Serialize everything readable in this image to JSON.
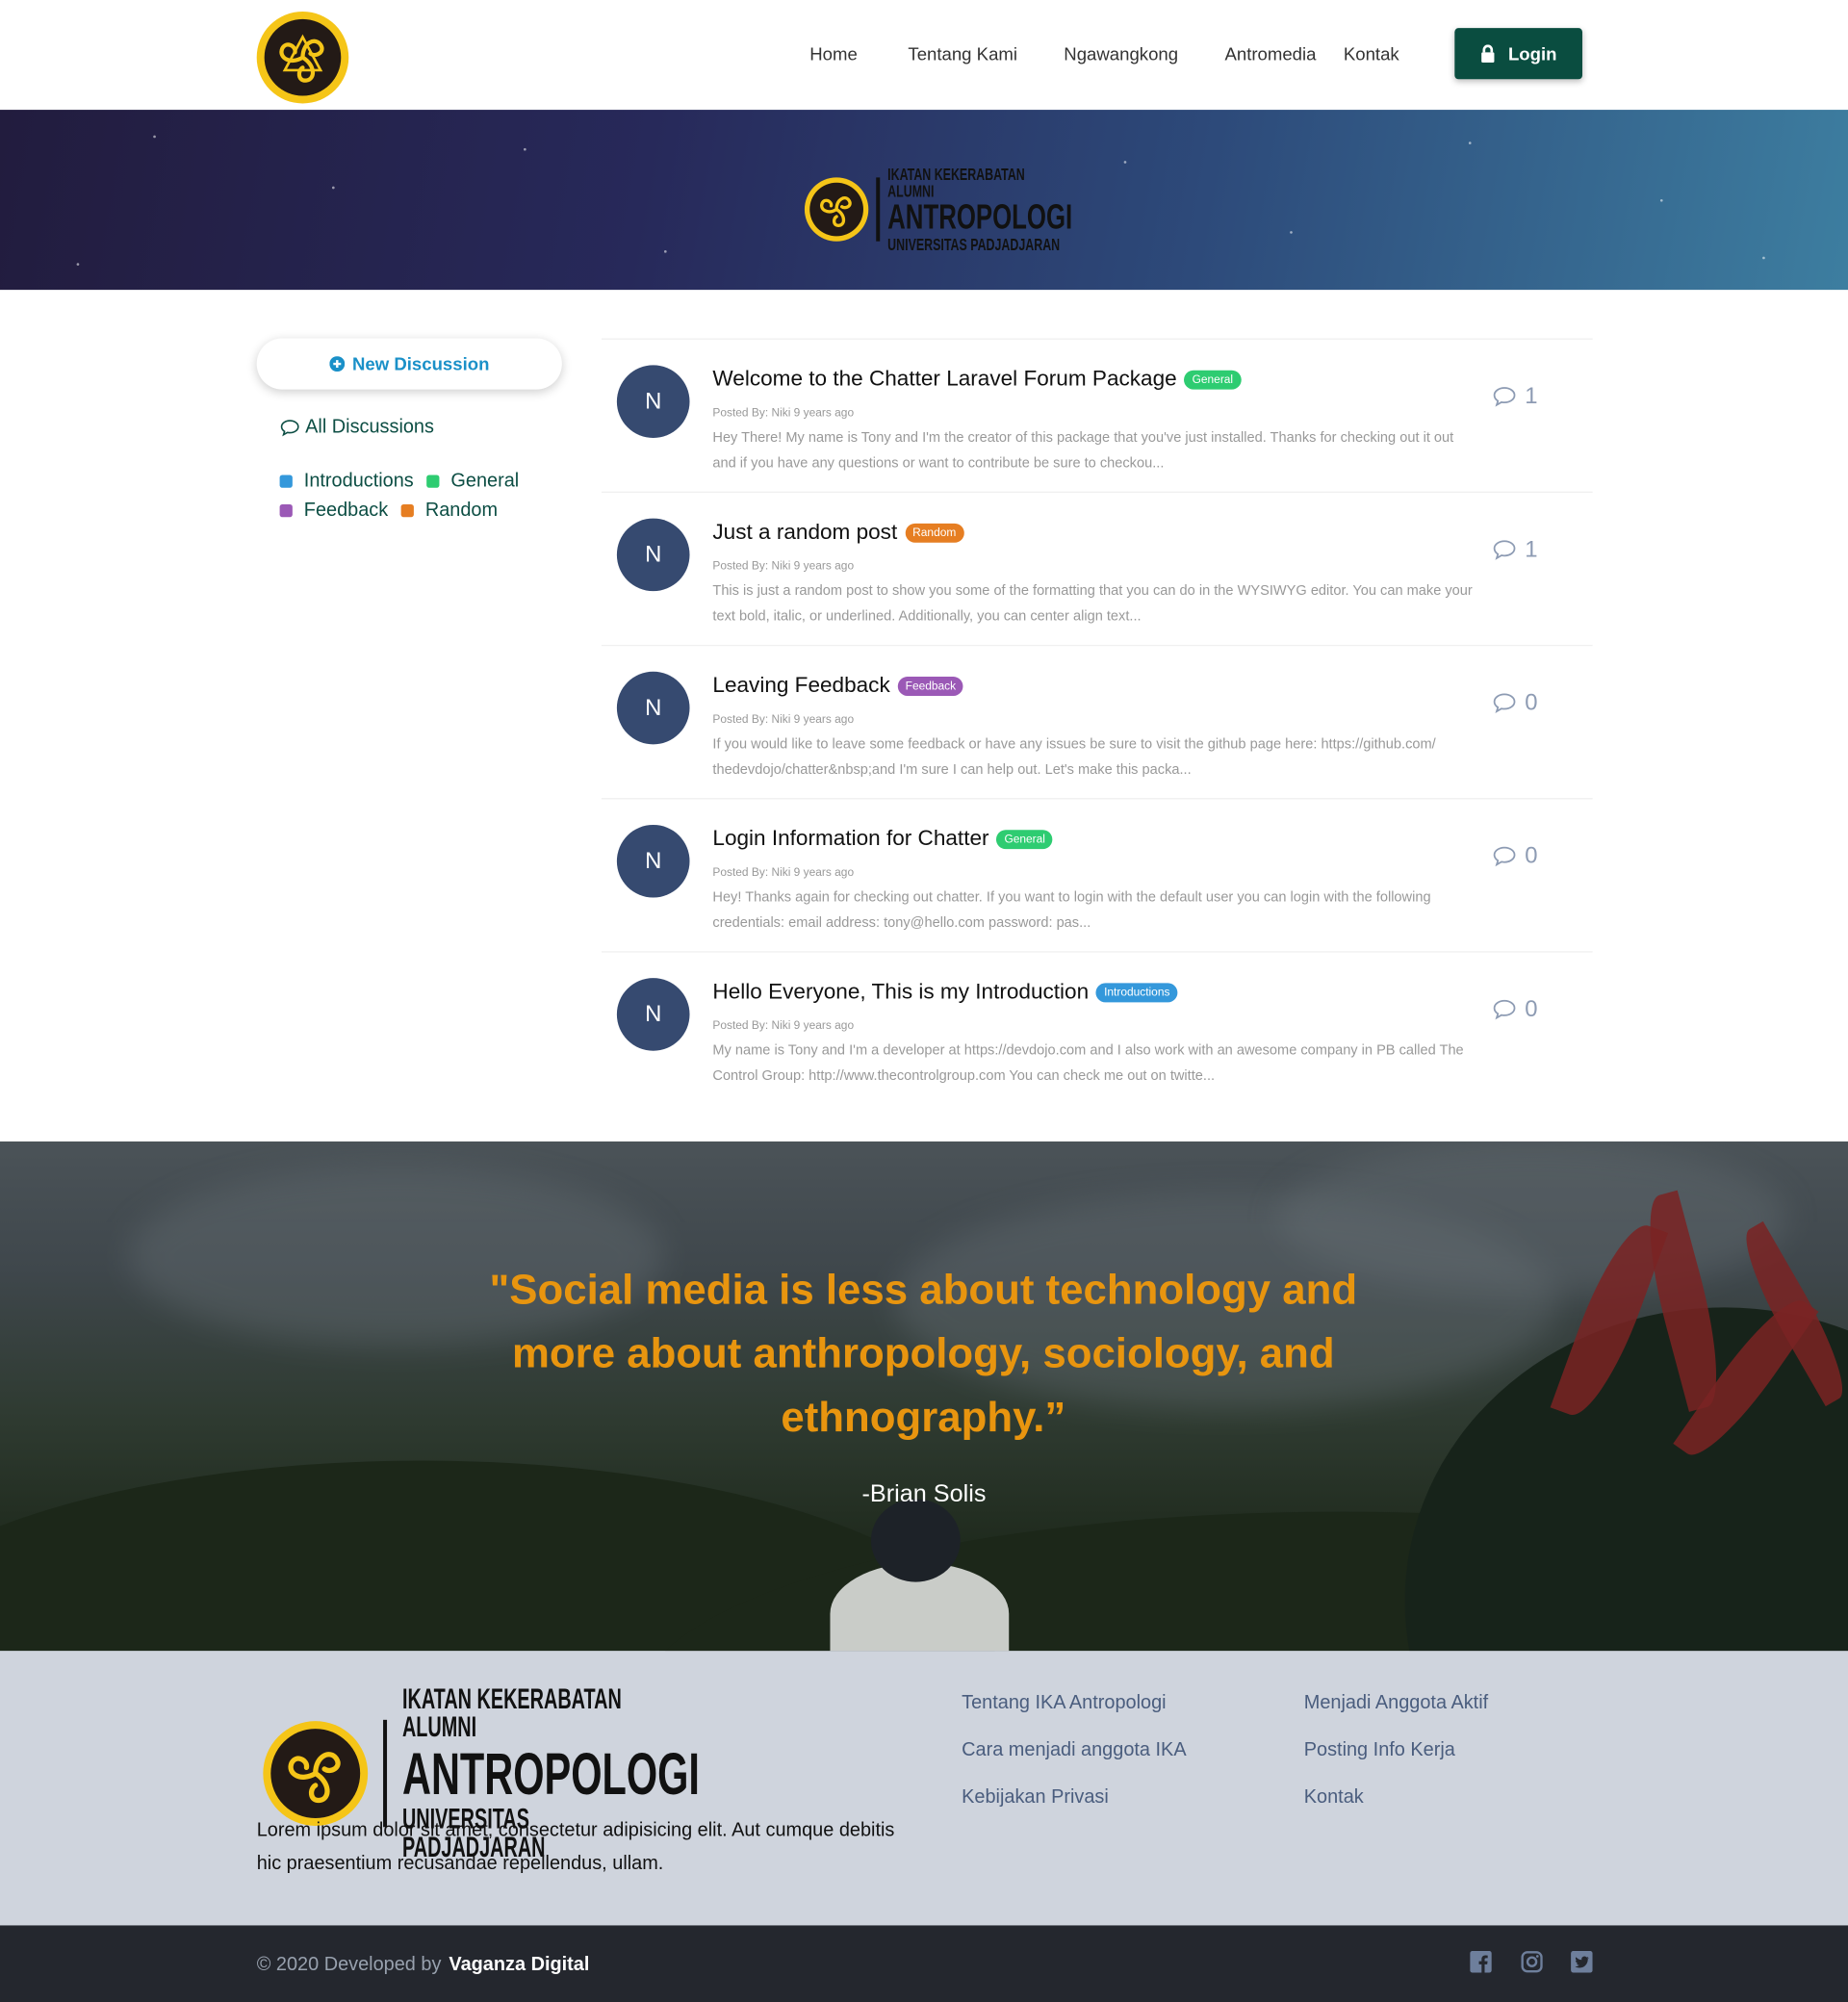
{
  "nav": {
    "items": [
      "Home",
      "Tentang Kami",
      "Ngawangkong",
      "Antromedia",
      "Kontak"
    ],
    "login_label": "Login"
  },
  "brand": {
    "line1": "IKATAN KEKERABATAN ALUMNI",
    "line2": "ANTROPOLOGI",
    "line3": "UNIVERSITAS PADJADJARAN"
  },
  "sidebar": {
    "new_discussion_label": "New Discussion",
    "all_discussions_label": "All Discussions",
    "categories": [
      {
        "label": "Introductions",
        "color": "#3498db"
      },
      {
        "label": "General",
        "color": "#2ecc71"
      },
      {
        "label": "Feedback",
        "color": "#9b59b6"
      },
      {
        "label": "Random",
        "color": "#e67e22"
      }
    ]
  },
  "discussions": [
    {
      "avatar": "N",
      "title": "Welcome to the Chatter Laravel Forum Package",
      "category": "General",
      "category_color": "#2ecc71",
      "posted_by": "Posted By: Niki 9 years ago",
      "excerpt": "Hey There! My name is Tony and I'm the creator of this package that you've just installed. Thanks for checking out it out and if you have any questions or want to contribute be sure to checkou...",
      "comments": "1"
    },
    {
      "avatar": "N",
      "title": "Just a random post",
      "category": "Random",
      "category_color": "#e67e22",
      "posted_by": "Posted By: Niki 9 years ago",
      "excerpt": "This is just a random post to show you some of the formatting that you can do in the WYSIWYG editor. You can make your text bold, italic, or underlined. Additionally, you can center align text...",
      "comments": "1"
    },
    {
      "avatar": "N",
      "title": "Leaving Feedback",
      "category": "Feedback",
      "category_color": "#9b59b6",
      "posted_by": "Posted By: Niki 9 years ago",
      "excerpt": "If you would like to leave some feedback or have any issues be sure to visit the github page here: https://github.com/ thedevdojo/chatter&nbsp;and I'm sure I can help out. Let's make this packa...",
      "comments": "0"
    },
    {
      "avatar": "N",
      "title": "Login Information for Chatter",
      "category": "General",
      "category_color": "#2ecc71",
      "posted_by": "Posted By: Niki 9 years ago",
      "excerpt": "Hey! Thanks again for checking out chatter. If you want to login with the default user you can login with the following credentials: email address: tony@hello.com password: pas...",
      "comments": "0"
    },
    {
      "avatar": "N",
      "title": "Hello Everyone, This is my Introduction",
      "category": "Introductions",
      "category_color": "#3498db",
      "posted_by": "Posted By: Niki 9 years ago",
      "excerpt": "My name is Tony and I'm a developer at https://devdojo.com and I also work with an awesome company in PB called The Control Group: http://www.thecontrolgroup.com You can check me out on twitte...",
      "comments": "0"
    }
  ],
  "quote": {
    "text": "\"Social media is less about technology and more about anthropology, sociology, and ethnography.”",
    "author": "-Brian Solis"
  },
  "footer": {
    "description": "Lorem ipsum dolor sit amet, consectetur adipisicing elit. Aut cumque debitis hic praesentium recusandae repellendus, ullam.",
    "links_col1": [
      "Tentang IKA Antropologi",
      "Cara menjadi anggota IKA",
      "Kebijakan Privasi"
    ],
    "links_col2": [
      "Menjadi Anggota Aktif",
      "Posting Info Kerja",
      "Kontak"
    ],
    "copyright": "© 2020 Developed by",
    "developer": "Vaganza Digital",
    "social_icons": [
      "facebook-icon",
      "instagram-icon",
      "twitter-icon"
    ]
  }
}
